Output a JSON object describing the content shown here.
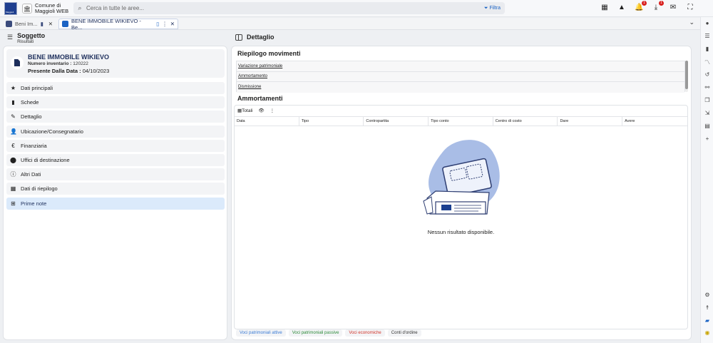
{
  "header": {
    "logo_text": "Maggioli",
    "org_line1": "Comune di",
    "org_line2": "Maggioli WEB",
    "search_placeholder": "Cerca in tutte le aree...",
    "filter_label": "Filtra",
    "notifications_count": "1",
    "downloads_count": "1"
  },
  "tabs": [
    {
      "label": "Beni Im..."
    },
    {
      "label": "BENE IMMOBILE WIKIEVO - Be..."
    }
  ],
  "left": {
    "title": "Soggetto",
    "subtitle": "Risultati",
    "asset_name": "BENE IMMOBILE WIKIEVO",
    "inventory_label": "Numero inventario :",
    "inventory_value": "120222",
    "present_label": "Presente Dalla Data :",
    "present_value": "04/10/2023",
    "nav": [
      {
        "label": "Dati principali",
        "icon": "star-icon"
      },
      {
        "label": "Schede",
        "icon": "file-icon"
      },
      {
        "label": "Dettaglio",
        "icon": "wand-icon"
      },
      {
        "label": "Ubicazione/Consegnatario",
        "icon": "person-icon"
      },
      {
        "label": "Finanziaria",
        "icon": "euro-icon"
      },
      {
        "label": "Uffici di destinazione",
        "icon": "pin-icon"
      },
      {
        "label": "Altri Dati",
        "icon": "info-icon"
      },
      {
        "label": "Dati di riepilogo",
        "icon": "calculator-icon"
      },
      {
        "label": "Prime note",
        "icon": "grid-icon"
      }
    ]
  },
  "right": {
    "title": "Dettaglio",
    "riepilogo_title": "Riepilogo movimenti",
    "movements": [
      "Variazione patrimoniale",
      "Ammortamento",
      "Dismissione"
    ],
    "ammortamenti_title": "Ammortamenti",
    "totali_label": "Totali",
    "columns": [
      "Data",
      "Tipo",
      "Contropartita",
      "Tipo conto",
      "Centro di costo",
      "Dare",
      "Avere"
    ],
    "empty_message": "Nessun risultato disponibile.",
    "legend": [
      {
        "label": "Voci patrimoniali attive",
        "color": "#3a7bd5"
      },
      {
        "label": "Voci patrimoniali passive",
        "color": "#2e8b3a"
      },
      {
        "label": "Voci economiche",
        "color": "#d2352b"
      },
      {
        "label": "Conti d'ordine",
        "color": "#333333"
      }
    ]
  }
}
